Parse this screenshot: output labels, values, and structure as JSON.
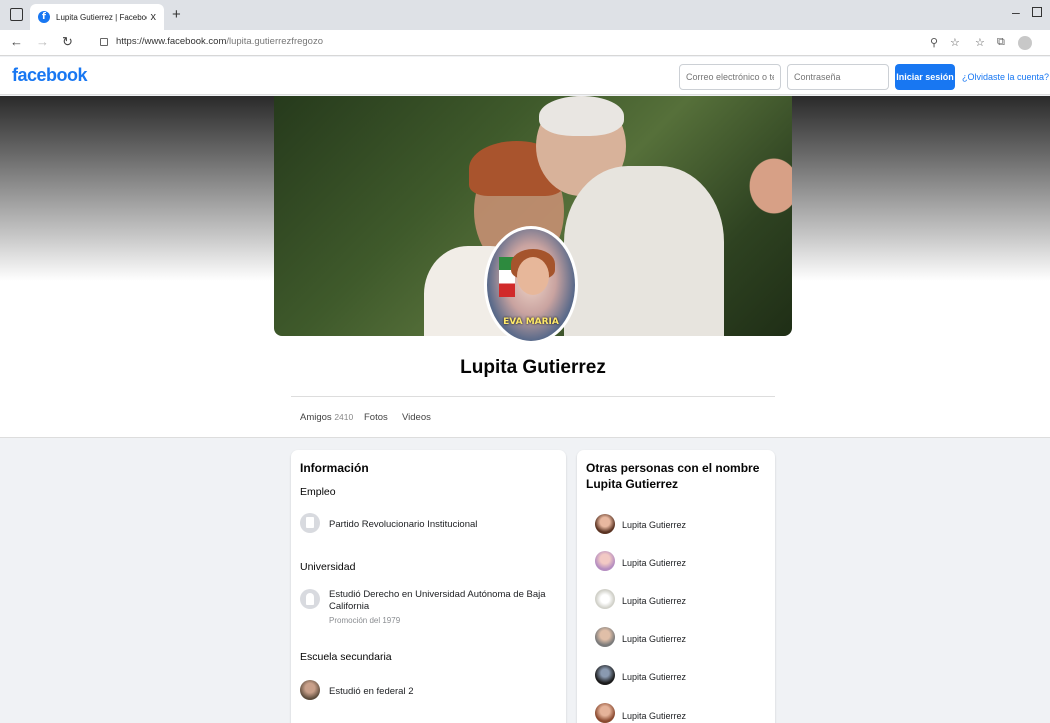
{
  "browser": {
    "tab_title": "Lupita Gutierrez | Facebook",
    "tab_close": "x",
    "new_tab": "+",
    "url_host": "https://www.facebook.com",
    "url_path": "/lupita.gutierrezfregozo"
  },
  "header": {
    "logo": "facebook",
    "email_placeholder": "Correo electrónico o tel",
    "password_placeholder": "Contraseña",
    "login_label": "Iniciar sesión",
    "forgot_label": "¿Olvidaste la cuenta?"
  },
  "profile": {
    "name": "Lupita Gutierrez",
    "avatar_badge": "EVA MARIA",
    "tabs": [
      {
        "label": "Amigos",
        "count": "2410"
      },
      {
        "label": "Fotos"
      },
      {
        "label": "Videos"
      }
    ]
  },
  "info": {
    "title": "Información",
    "employment_title": "Empleo",
    "employment": "Partido Revolucionario Institucional",
    "university_title": "Universidad",
    "university_line1": "Estudió Derecho en Universidad Autónoma de Baja",
    "university_line2": "California",
    "university_class": "Promoción del 1979",
    "school_title": "Escuela secundaria",
    "school": "Estudió en federal 2"
  },
  "others": {
    "title_line1": "Otras personas con el nombre",
    "title_line2": "Lupita Gutierrez",
    "people": [
      {
        "name": "Lupita Gutierrez"
      },
      {
        "name": "Lupita Gutierrez"
      },
      {
        "name": "Lupita Gutierrez"
      },
      {
        "name": "Lupita Gutierrez"
      },
      {
        "name": "Lupita Gutierrez"
      },
      {
        "name": "Lupita Gutierrez"
      }
    ]
  },
  "colors": {
    "brand": "#1877f2",
    "page_bg": "#f0f2f5"
  }
}
